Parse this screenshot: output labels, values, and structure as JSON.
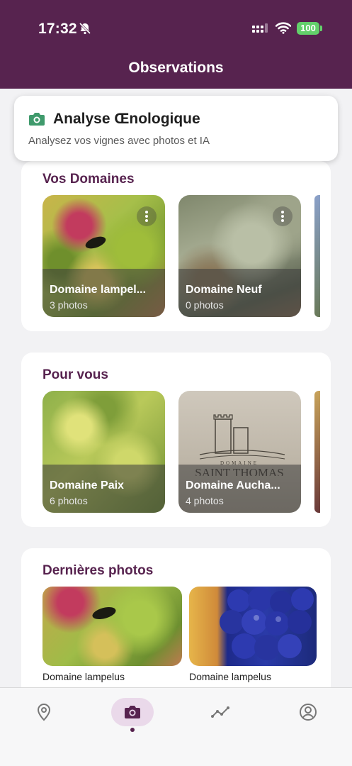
{
  "status_bar": {
    "time": "17:32",
    "battery": "100"
  },
  "header": {
    "title": "Observations"
  },
  "analyse_card": {
    "title": "Analyse Œnologique",
    "subtitle": "Analysez vos vignes avec photos et IA"
  },
  "domaines": {
    "title": "Vos Domaines",
    "items": [
      {
        "name": "Domaine lampel...",
        "count": "3 photos"
      },
      {
        "name": "Domaine Neuf",
        "count": "0 photos"
      }
    ]
  },
  "pour_vous": {
    "title": "Pour vous",
    "items": [
      {
        "name": "Domaine Paix",
        "count": "6 photos"
      },
      {
        "name": "Domaine Aucha...",
        "count": "4 photos"
      }
    ]
  },
  "photos": {
    "title": "Dernières photos",
    "items": [
      {
        "caption": "Domaine lampelus"
      },
      {
        "caption": "Domaine lampelus"
      }
    ]
  },
  "tabs": [
    "map-pin-icon",
    "camera-icon",
    "trend-icon",
    "profile-icon"
  ],
  "colors": {
    "brand": "#57234f",
    "accent_green": "#3f9a6c",
    "battery": "#63d06b"
  }
}
